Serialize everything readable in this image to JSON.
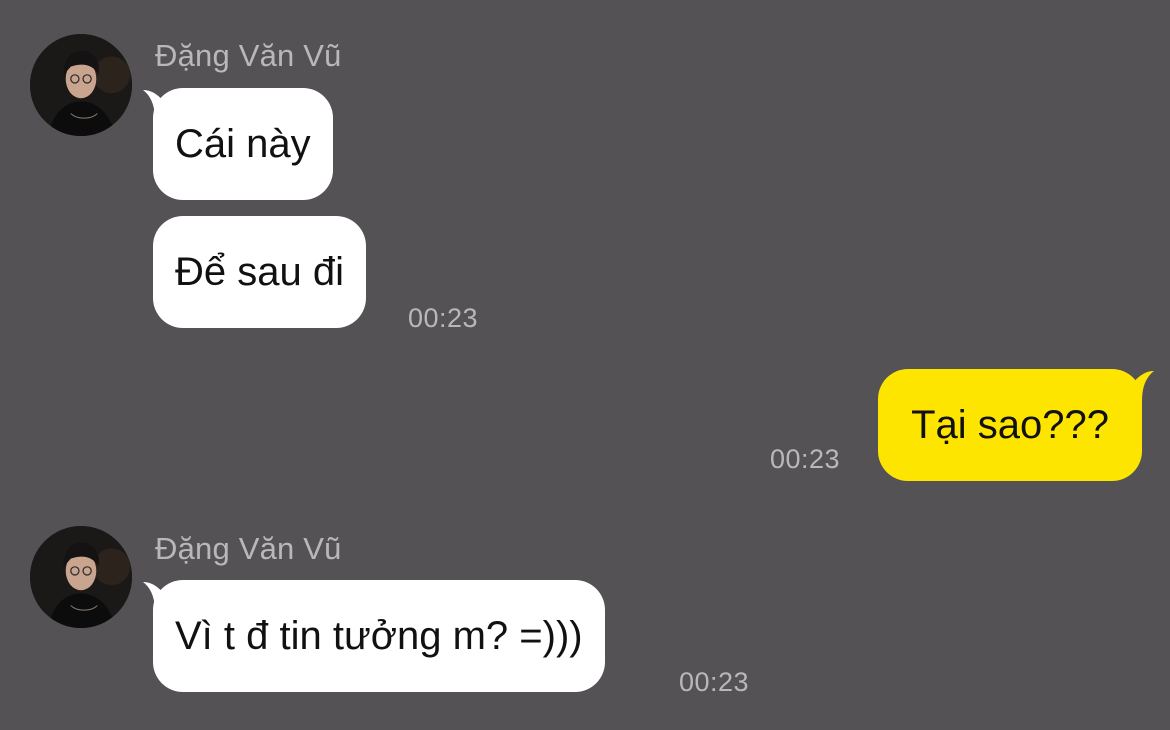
{
  "colors": {
    "background": "#545255",
    "incoming_bubble": "#ffffff",
    "outgoing_bubble": "#fee500",
    "meta_text": "#b9b7ba"
  },
  "icons": {
    "avatar": "profile-photo"
  },
  "messages": [
    {
      "sender_name": "Đặng Văn Vũ",
      "bubbles": [
        "Cái này",
        "Để sau đi"
      ],
      "time": "00:23"
    },
    {
      "outgoing": true,
      "text": "Tại sao???",
      "time": "00:23"
    },
    {
      "sender_name": "Đặng Văn Vũ",
      "bubbles": [
        "Vì t đ tin tưởng m? =)))"
      ],
      "time": "00:23"
    }
  ]
}
